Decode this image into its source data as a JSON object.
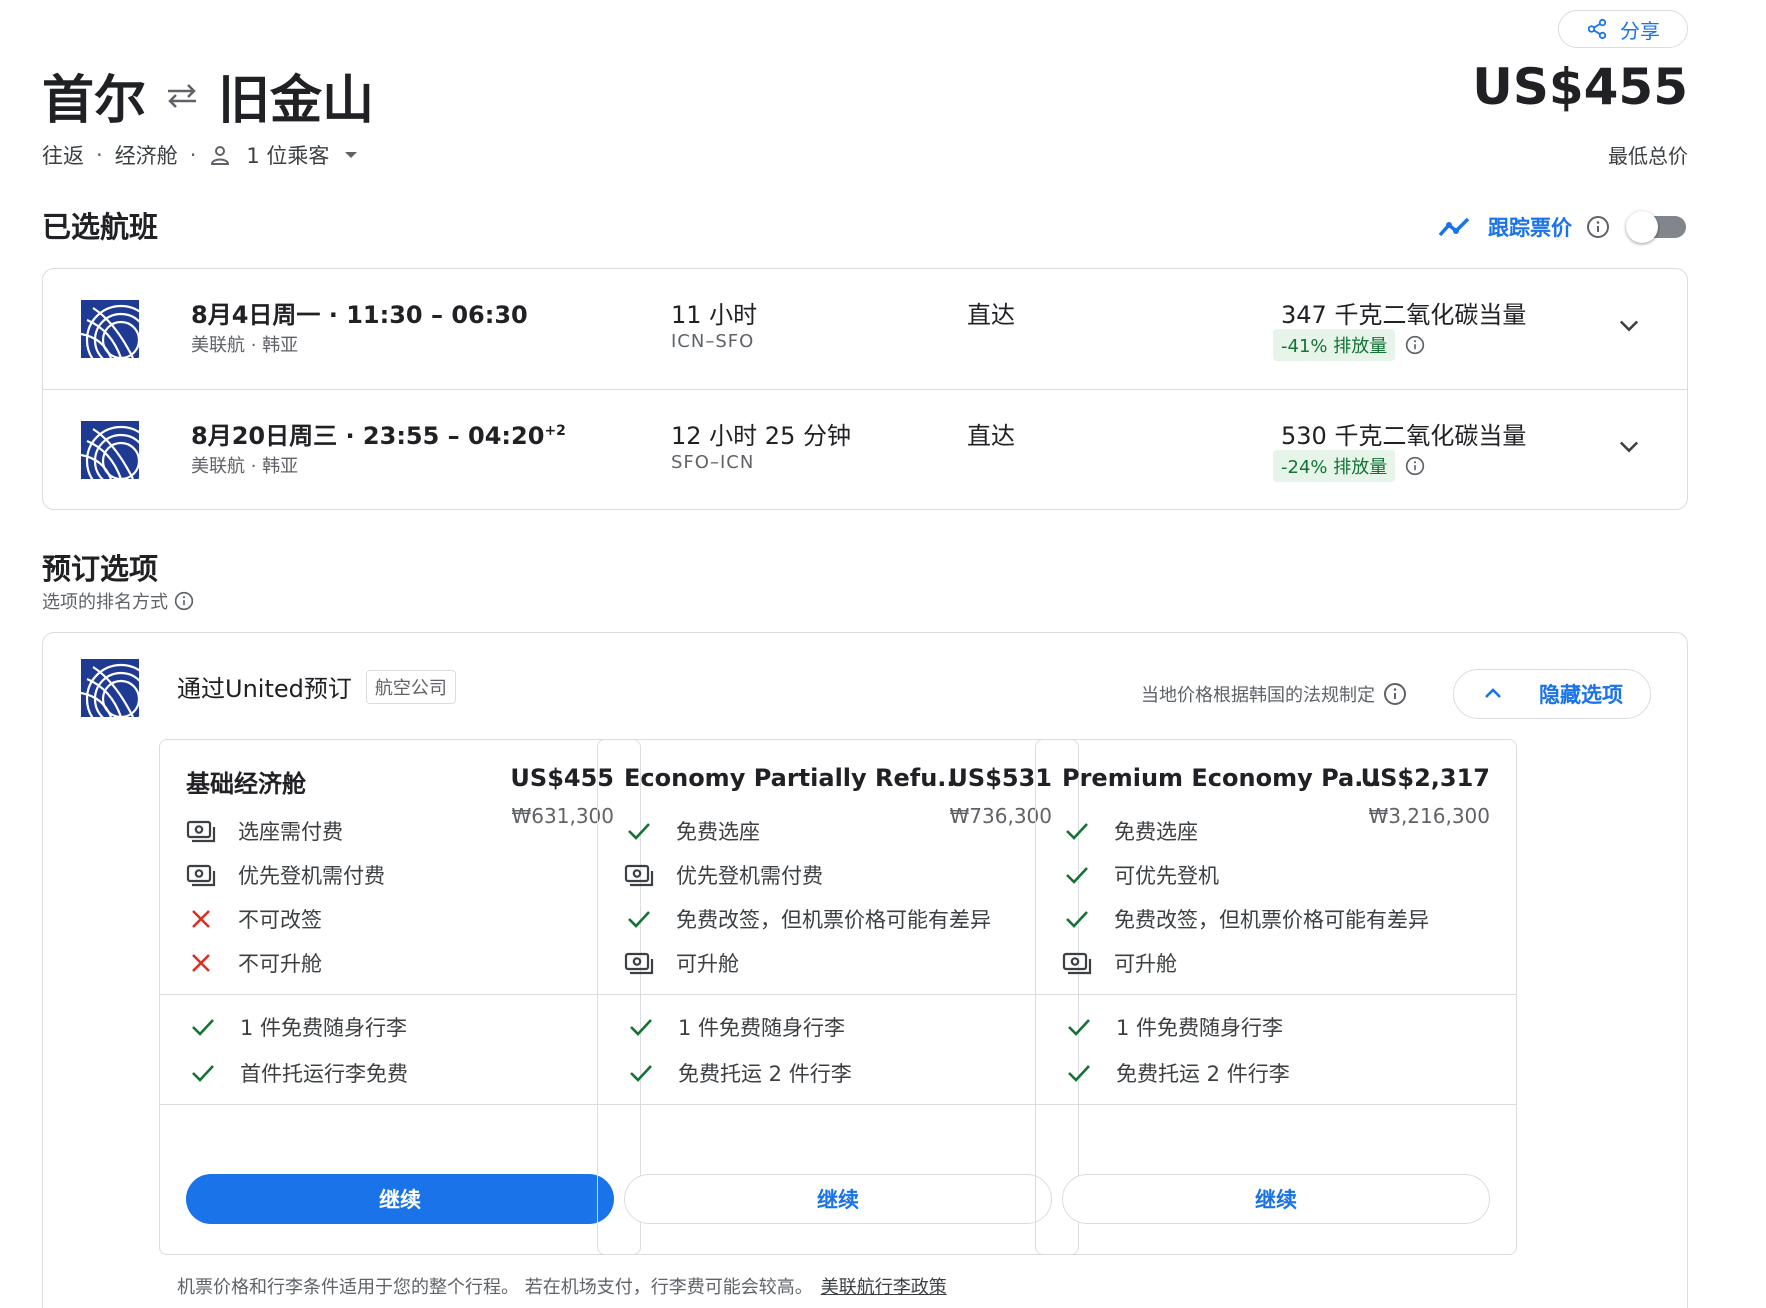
{
  "header": {
    "share_label": "分享",
    "origin": "首尔",
    "destination": "旧金山",
    "price": "US$455",
    "price_note": "最低总价",
    "trip_type": "往返",
    "cabin": "经济舱",
    "passengers": "1 位乘客"
  },
  "selected": {
    "title": "已选航班",
    "track_label": "跟踪票价"
  },
  "flights": [
    {
      "time": "8月4日周一 · 11:30 – 06:30",
      "time_sup": "",
      "airline": "美联航 · 韩亚",
      "duration": "11 小时",
      "route": "ICN–SFO",
      "stops": "直达",
      "co2": "347 千克二氧化碳当量",
      "emission": "-41% 排放量"
    },
    {
      "time": "8月20日周三 · 23:55 – 04:20",
      "time_sup": "+2",
      "airline": "美联航 · 韩亚",
      "duration": "12 小时 25 分钟",
      "route": "SFO–ICN",
      "stops": "直达",
      "co2": "530 千克二氧化碳当量",
      "emission": "-24% 排放量"
    }
  ],
  "booking": {
    "title": "预订选项",
    "sort_note": "选项的排名方式",
    "vendor": "通过United预订",
    "vendor_tag": "航空公司",
    "local_note": "当地价格根据韩国的法规制定",
    "hide_label": "隐藏选项",
    "footnote": "机票价格和行李条件适用于您的整个行程。 若在机场支付，行李费可能会较高。",
    "policy_link": "美联航行李政策",
    "fares": [
      {
        "name": "基础经济舱",
        "usd": "US$455",
        "krw": "₩631,300",
        "features": [
          {
            "icon": "money",
            "text": "选座需付费"
          },
          {
            "icon": "money",
            "text": "优先登机需付费"
          },
          {
            "icon": "cross",
            "text": "不可改签"
          },
          {
            "icon": "cross",
            "text": "不可升舱"
          }
        ],
        "baggage": [
          "1 件免费随身行李",
          "首件托运行李免费"
        ],
        "continue": "继续",
        "primary": true
      },
      {
        "name": "Economy Partially Refu...",
        "usd": "US$531",
        "krw": "₩736,300",
        "features": [
          {
            "icon": "check",
            "text": "免费选座"
          },
          {
            "icon": "money",
            "text": "优先登机需付费"
          },
          {
            "icon": "check",
            "text": "免费改签，但机票价格可能有差异"
          },
          {
            "icon": "money",
            "text": "可升舱"
          }
        ],
        "baggage": [
          "1 件免费随身行李",
          "免费托运 2 件行李"
        ],
        "continue": "继续",
        "primary": false
      },
      {
        "name": "Premium Economy Pa...",
        "usd": "US$2,317",
        "krw": "₩3,216,300",
        "features": [
          {
            "icon": "check",
            "text": "免费选座"
          },
          {
            "icon": "check",
            "text": "可优先登机"
          },
          {
            "icon": "check",
            "text": "免费改签，但机票价格可能有差异"
          },
          {
            "icon": "money",
            "text": "可升舱"
          }
        ],
        "baggage": [
          "1 件免费随身行李",
          "免费托运 2 件行李"
        ],
        "continue": "继续",
        "primary": false
      }
    ]
  },
  "colors": {
    "accent": "#1a73e8",
    "green": "#137333",
    "red": "#d93025"
  }
}
